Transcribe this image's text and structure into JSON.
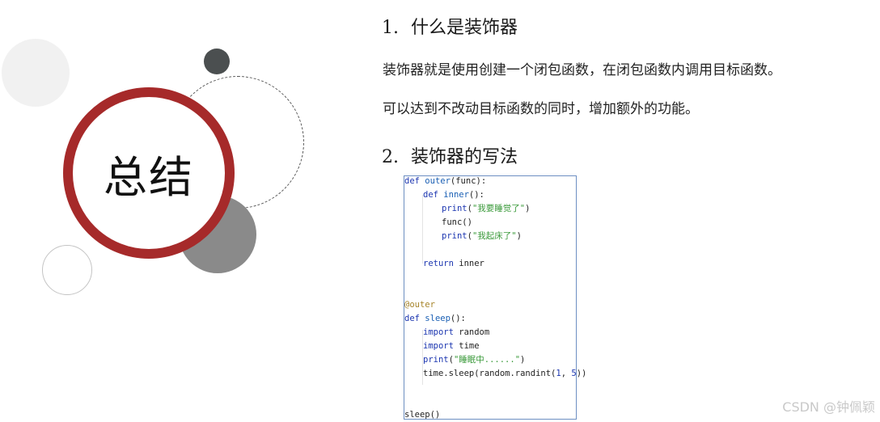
{
  "left_graphic": {
    "title": "总结"
  },
  "sections": [
    {
      "number": "1.",
      "title": "什么是装饰器"
    },
    {
      "number": "2.",
      "title": "装饰器的写法"
    }
  ],
  "paragraphs": [
    "装饰器就是使用创建一个闭包函数，在闭包函数内调用目标函数。",
    "可以达到不改动目标函数的同时，增加额外的功能。"
  ],
  "code": {
    "l1": {
      "kw": "def",
      "name": "outer",
      "rest": "(func):"
    },
    "l2": {
      "kw": "def",
      "name": "inner",
      "rest": "():"
    },
    "l3": {
      "fn": "print",
      "open": "(",
      "str": "\"我要睡觉了\"",
      "close": ")"
    },
    "l4": "func()",
    "l5": {
      "fn": "print",
      "open": "(",
      "str": "\"我起床了\"",
      "close": ")"
    },
    "l6": {
      "kw": "return",
      "rest": " inner"
    },
    "l7": "@outer",
    "l8": {
      "kw": "def",
      "name": "sleep",
      "rest": "():"
    },
    "l9": {
      "kw": "import",
      "rest": " random"
    },
    "l10": {
      "kw": "import",
      "rest": " time"
    },
    "l11": {
      "fn": "print",
      "open": "(",
      "str": "\"睡眠中......\"",
      "close": ")"
    },
    "l12": {
      "a": "time.sleep(random.randint(",
      "n1": "1",
      "sep": ", ",
      "n2": "5",
      "b": "))"
    },
    "l13": "sleep()"
  },
  "watermark": "CSDN @钟佩颖"
}
